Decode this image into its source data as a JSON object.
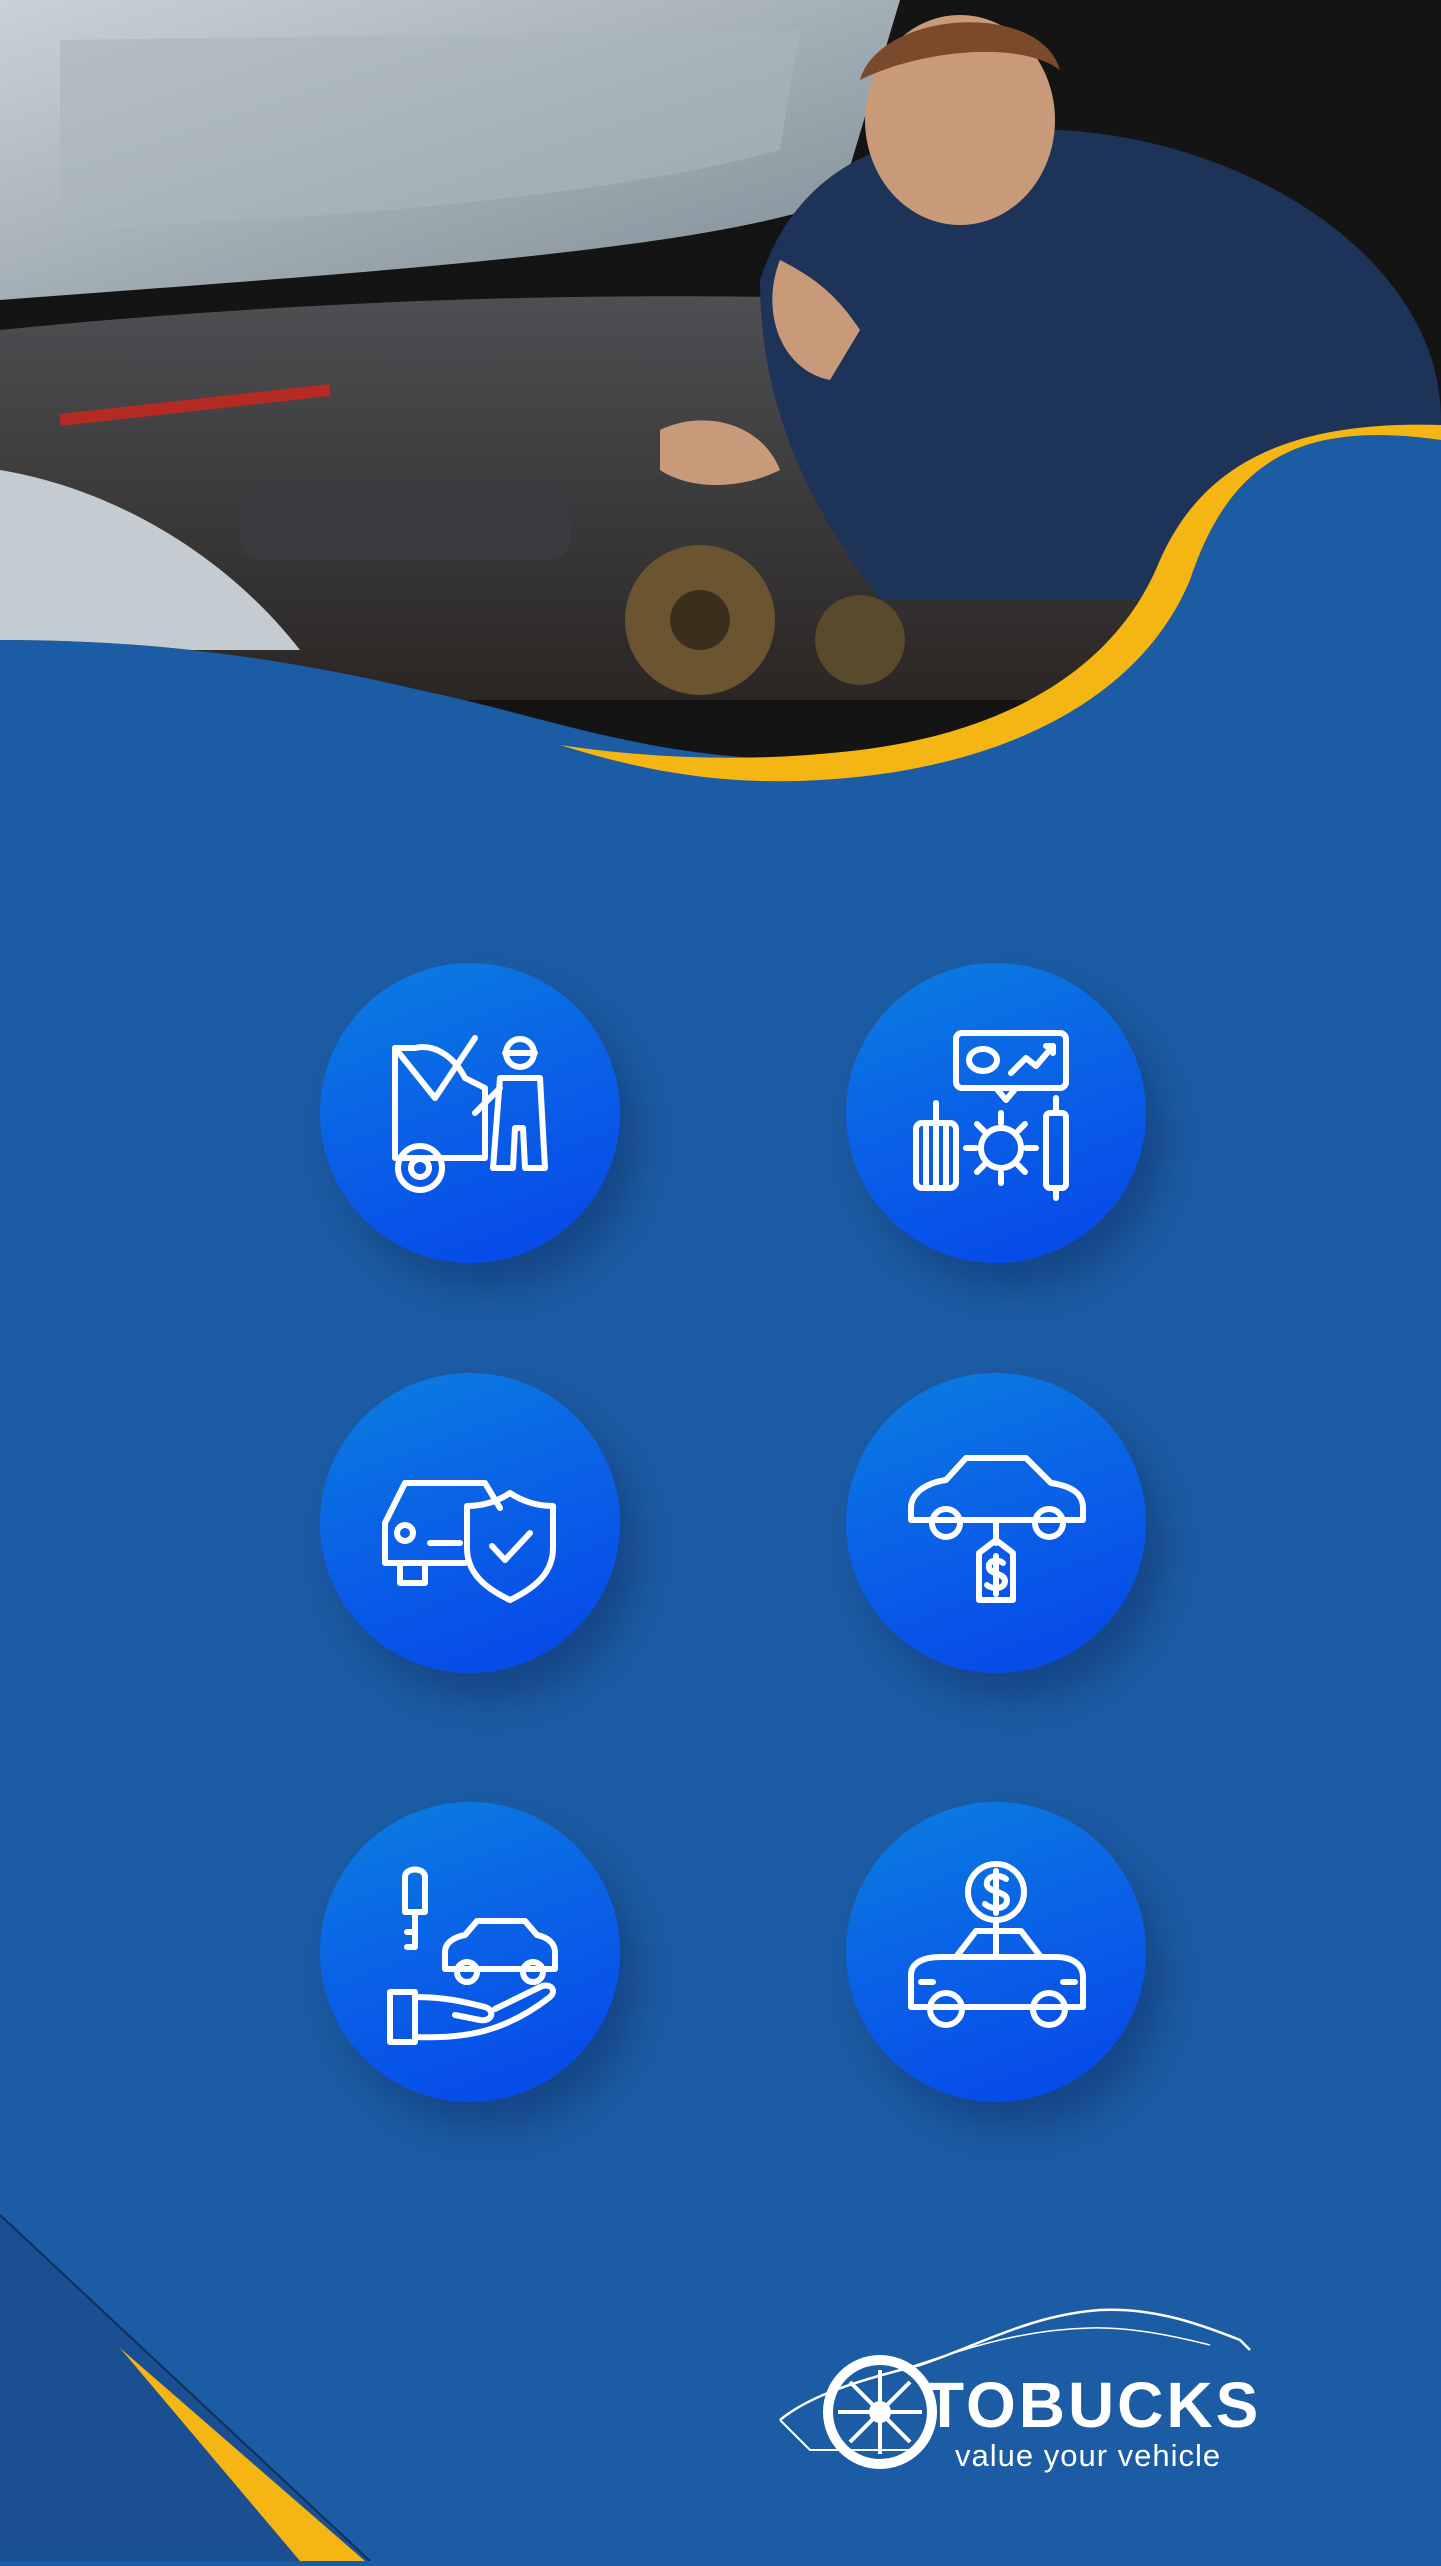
{
  "hero": {
    "photo": "mechanic-thumbs-up-at-open-car-engine"
  },
  "colors": {
    "background": "#1c5ca4",
    "accent": "#f5b614",
    "circle_top": "#0b7fe0",
    "circle_bottom": "#0645ea"
  },
  "icons": [
    {
      "name": "mechanic-repairing-car-icon"
    },
    {
      "name": "car-parts-analytics-icon"
    },
    {
      "name": "car-protection-shield-icon"
    },
    {
      "name": "car-price-tag-icon"
    },
    {
      "name": "car-key-handover-icon"
    },
    {
      "name": "car-dollar-icon"
    }
  ],
  "brand": {
    "name": "TOBUCKS",
    "tagline": "value your vehicle"
  }
}
